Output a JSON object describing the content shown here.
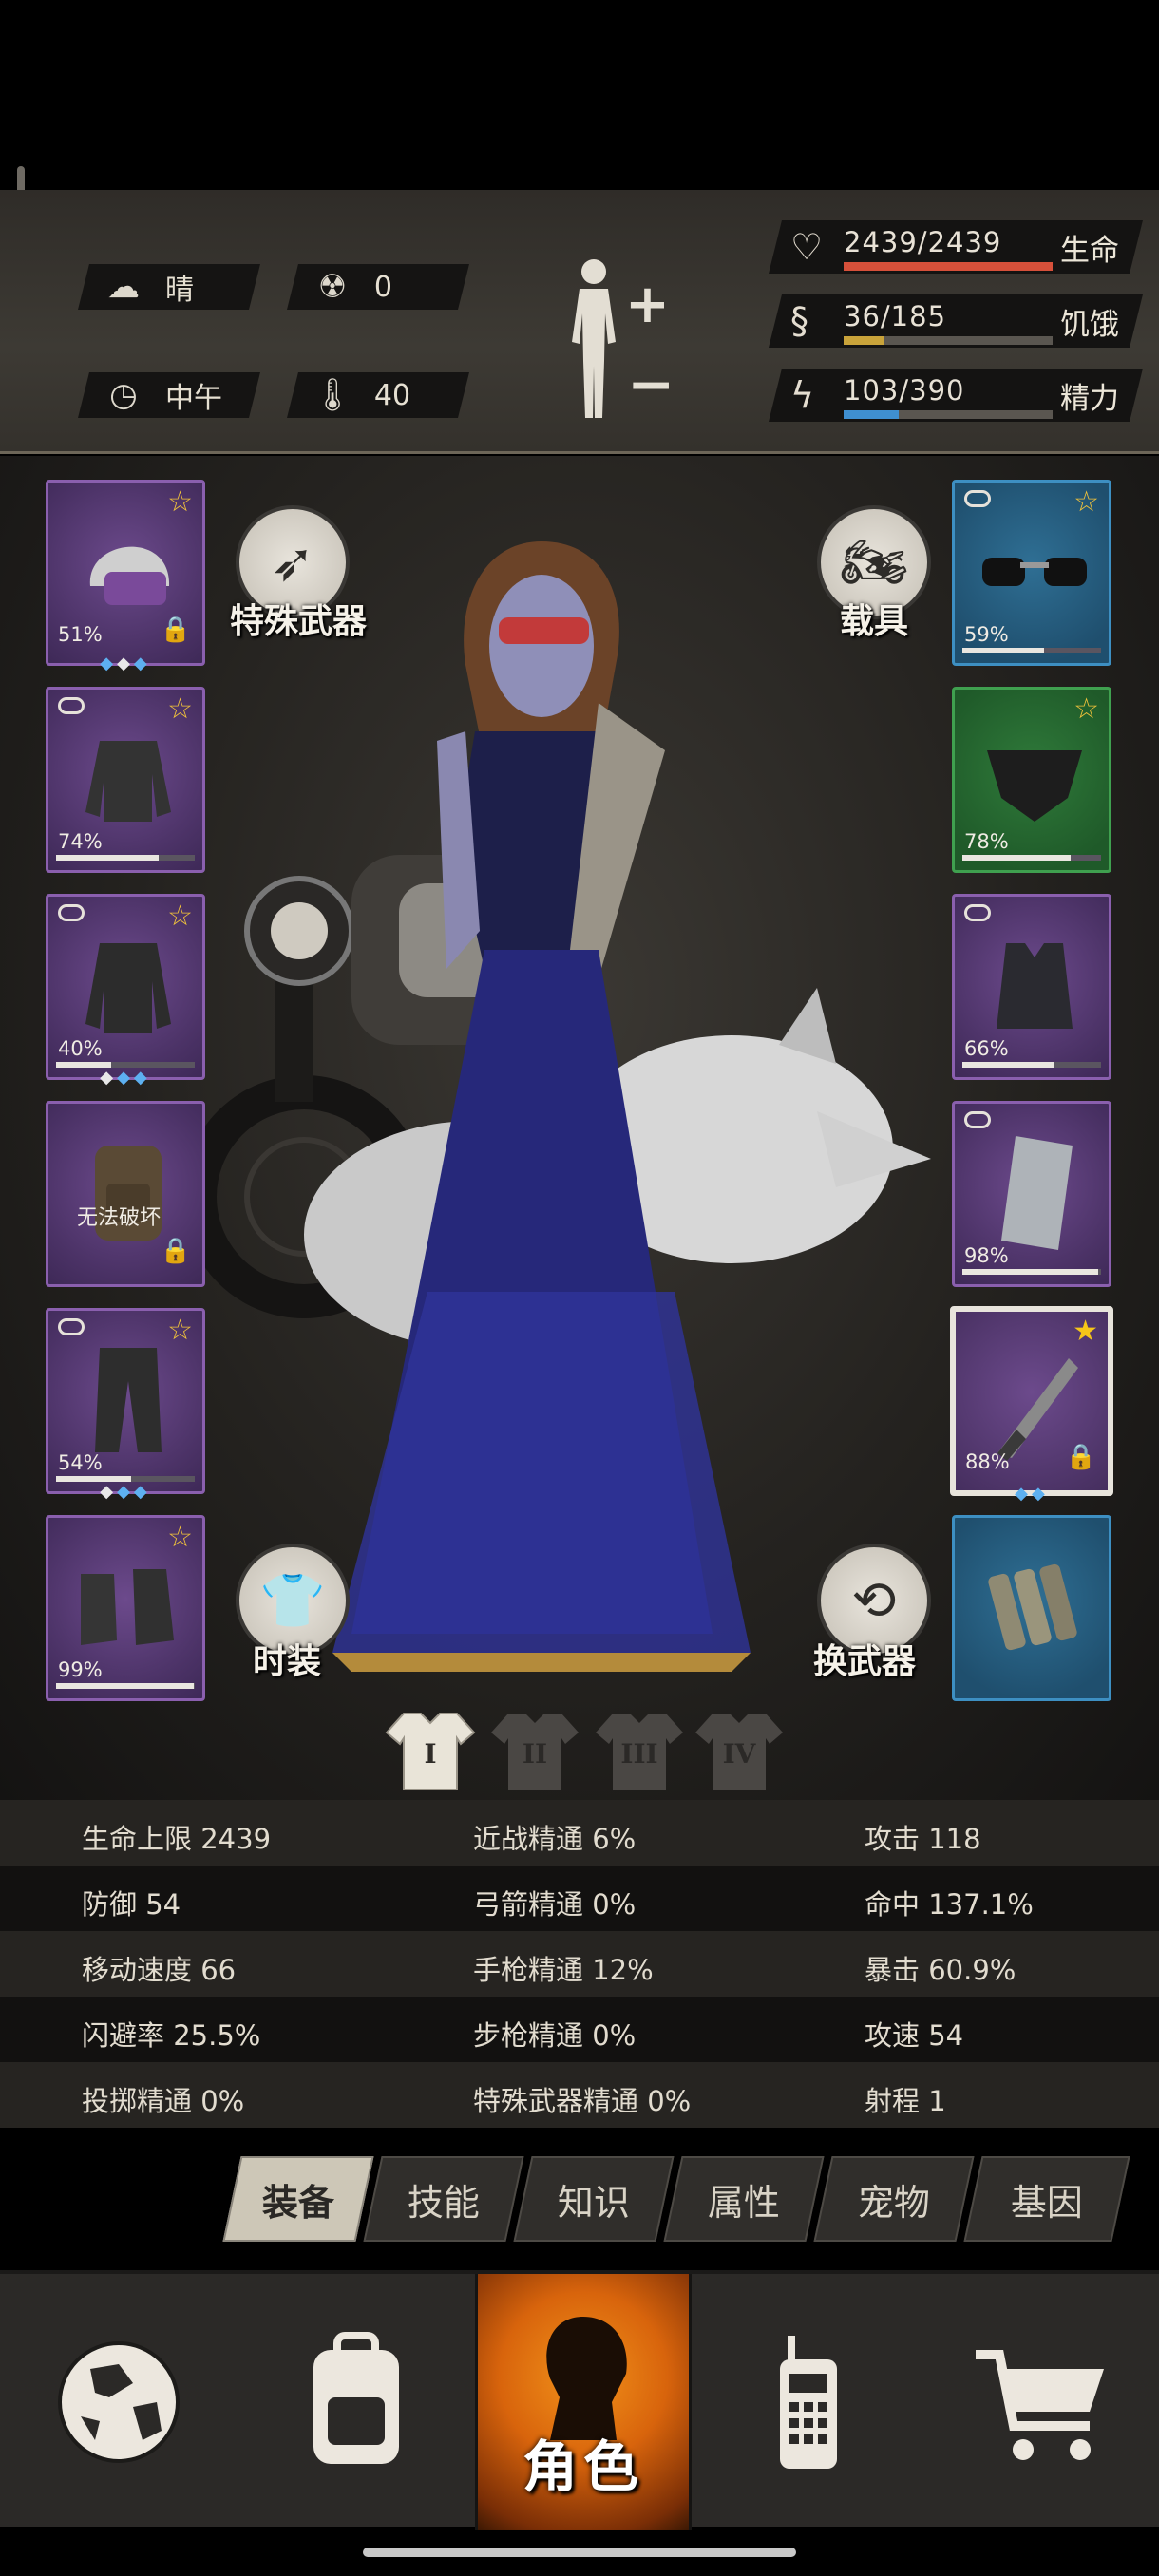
{
  "status": {
    "weather": {
      "icon": "cloud-sun-icon",
      "label": "晴"
    },
    "radiation": {
      "icon": "radiation-icon",
      "value": "0"
    },
    "time": {
      "icon": "clock-icon",
      "label": "中午"
    },
    "temperature": {
      "icon": "thermometer-icon",
      "value": "40"
    },
    "bars": [
      {
        "icon": "heart-icon",
        "value": "2439/2439",
        "label": "生命",
        "fraction": 1.0,
        "color": "#d6503a"
      },
      {
        "icon": "stomach-icon",
        "value": "36/185",
        "label": "饥饿",
        "fraction": 0.195,
        "color": "#c9a33a"
      },
      {
        "icon": "head-energy-icon",
        "value": "103/390",
        "label": "精力",
        "fraction": 0.264,
        "color": "#3f8fd0"
      }
    ]
  },
  "equipment": {
    "left": [
      {
        "name": "helmet",
        "percent": "51%",
        "durability": 0.51,
        "star": true,
        "locked": true,
        "linked": false,
        "gems": [
          "b",
          "w",
          "b"
        ],
        "border": "purple"
      },
      {
        "name": "jacket",
        "percent": "74%",
        "durability": 0.74,
        "star": true,
        "linked": true,
        "border": "purple"
      },
      {
        "name": "coat",
        "percent": "40%",
        "durability": 0.4,
        "star": true,
        "linked": true,
        "gems": [
          "w",
          "b",
          "b"
        ],
        "border": "purple"
      },
      {
        "name": "backpack",
        "status": "无法破坏",
        "locked": true,
        "border": "purple"
      },
      {
        "name": "pants",
        "percent": "54%",
        "durability": 0.54,
        "star": true,
        "linked": true,
        "gems": [
          "w",
          "b",
          "b"
        ],
        "border": "purple"
      },
      {
        "name": "boots",
        "percent": "99%",
        "durability": 0.99,
        "star": true,
        "border": "purple"
      }
    ],
    "right": [
      {
        "name": "sunglasses",
        "percent": "59%",
        "durability": 0.59,
        "star": true,
        "linked": true,
        "border": "blue"
      },
      {
        "name": "gas-mask",
        "percent": "78%",
        "durability": 0.78,
        "star": true,
        "border": "green"
      },
      {
        "name": "police-vest",
        "percent": "66%",
        "durability": 0.66,
        "linked": true,
        "border": "purple"
      },
      {
        "name": "riot-shield",
        "percent": "98%",
        "durability": 0.98,
        "linked": true,
        "border": "purple"
      },
      {
        "name": "weapon",
        "percent": "88%",
        "durability": 0.88,
        "star": true,
        "locked": true,
        "gems": [
          "b",
          "b"
        ],
        "border": "purple"
      },
      {
        "name": "explosive-bundle",
        "border": "blue"
      }
    ]
  },
  "buttons": {
    "special_weapon": "特殊武器",
    "vehicle": "载具",
    "fashion": "时装",
    "switch_weapon": "换武器"
  },
  "outfit_tabs": [
    "I",
    "II",
    "III",
    "IV"
  ],
  "stats": [
    [
      "生命上限 2439",
      "近战精通 6%",
      "攻击 118"
    ],
    [
      "防御 54",
      "弓箭精通 0%",
      "命中 137.1%"
    ],
    [
      "移动速度 66",
      "手枪精通 12%",
      "暴击 60.9%"
    ],
    [
      "闪避率 25.5%",
      "步枪精通 0%",
      "攻速 54"
    ],
    [
      "投掷精通 0%",
      "特殊武器精通 0%",
      "射程 1"
    ]
  ],
  "tabs": [
    "装备",
    "技能",
    "知识",
    "属性",
    "宠物",
    "基因"
  ],
  "active_tab": 0,
  "nav": [
    {
      "icon": "globe-icon",
      "label": ""
    },
    {
      "icon": "backpack-icon",
      "label": ""
    },
    {
      "icon": "character-icon",
      "label": "角色"
    },
    {
      "icon": "radio-icon",
      "label": ""
    },
    {
      "icon": "cart-icon",
      "label": ""
    }
  ]
}
